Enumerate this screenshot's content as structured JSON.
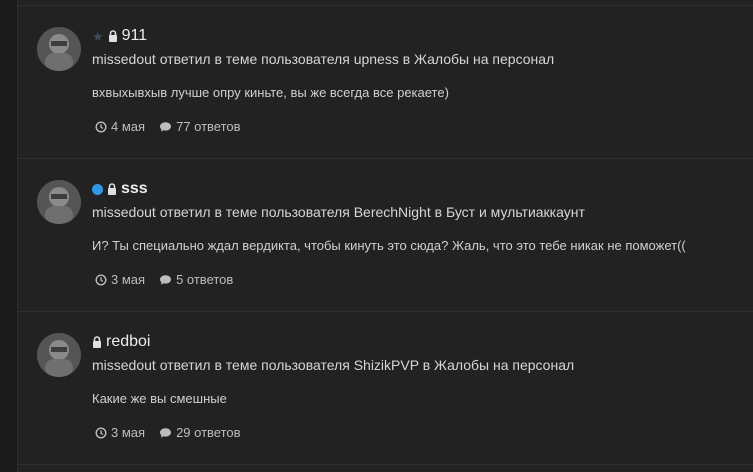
{
  "colors": {
    "background": "#1a1a1a",
    "panel": "#222222",
    "divider": "#2f2f2f",
    "online_dot": "#2b9be8",
    "star": "#3b4c5e"
  },
  "feed": {
    "items": [
      {
        "username": "911",
        "username_bold": false,
        "badges": [
          "star-icon",
          "lock-icon"
        ],
        "action": "missedout ответил в теме пользователя upness в Жалобы на персонал",
        "message": "вхвыхывхыв лучше опру киньте, вы же всегда все рекаете)",
        "date": "4 мая",
        "replies": "77 ответов"
      },
      {
        "username": "sss",
        "username_bold": true,
        "badges": [
          "online-dot",
          "lock-icon"
        ],
        "action": "missedout ответил в теме пользователя BerechNight в Буст и мультиаккаунт",
        "message": "И? Ты специально ждал вердикта, чтобы кинуть это сюда? Жаль, что это тебе никак не поможет((",
        "date": "3 мая",
        "replies": "5 ответов"
      },
      {
        "username": "redboi",
        "username_bold": false,
        "badges": [
          "lock-icon"
        ],
        "action": "missedout ответил в теме пользователя ShizikPVP в Жалобы на персонал",
        "message": "Какие же вы смешные",
        "date": "3 мая",
        "replies": "29 ответов"
      }
    ]
  }
}
